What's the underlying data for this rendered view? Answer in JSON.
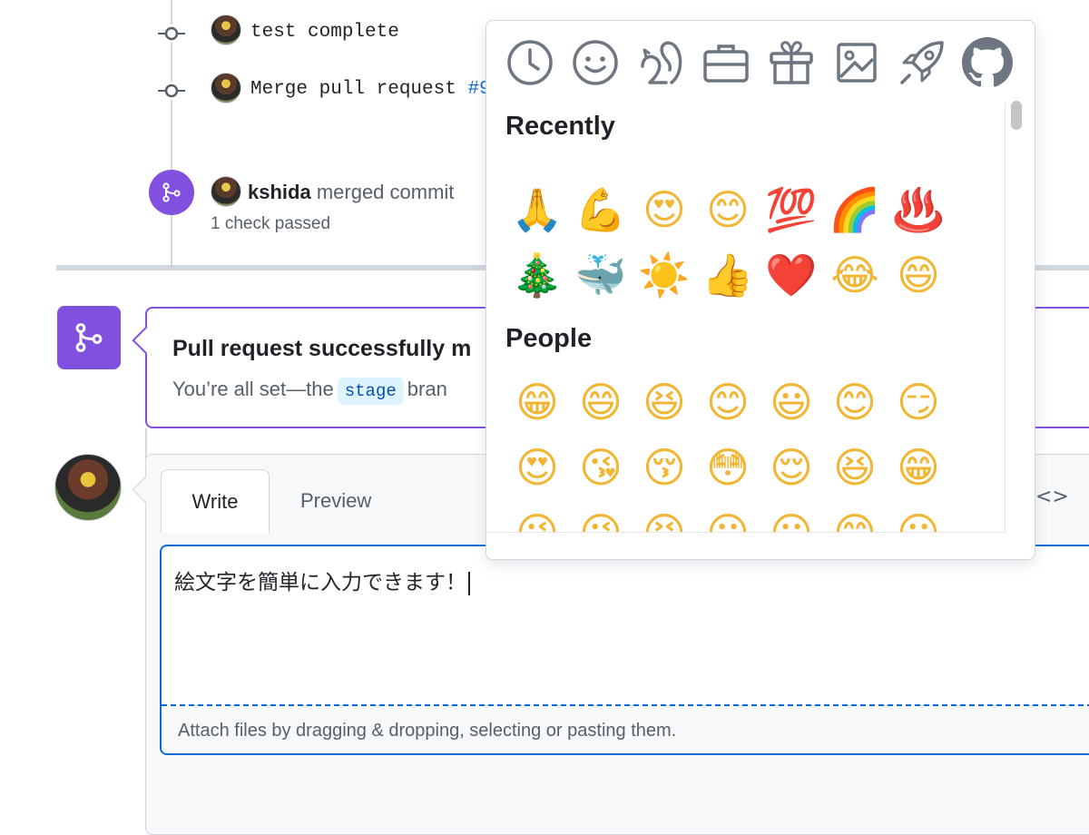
{
  "timeline": {
    "commits": [
      {
        "message": "test complete"
      },
      {
        "message_prefix": "Merge pull request ",
        "message_link": "#9"
      }
    ],
    "merge_event": {
      "user": "kshida",
      "action": "merged commit",
      "checks": "1 check passed"
    }
  },
  "merged_box": {
    "title": "Pull request successfully m",
    "desc_prefix": "You’re all set—the",
    "branch": "stage",
    "desc_suffix": "bran"
  },
  "composer": {
    "tabs": {
      "write": "Write",
      "preview": "Preview"
    },
    "text": "絵文字を簡単に入力できます！",
    "attach_hint": "Attach files by dragging & dropping, selecting or pasting them.",
    "code_toggle": "<>"
  },
  "emoji_picker": {
    "categories": [
      "clock-icon",
      "smiley-icon",
      "squirrel-icon",
      "briefcase-icon",
      "gift-icon",
      "image-icon",
      "rocket-icon",
      "github-icon"
    ],
    "sections": [
      {
        "title": "Recently",
        "rows": [
          [
            "🙏",
            "💪",
            "😍",
            "😊",
            "💯",
            "🌈",
            "♨️"
          ],
          [
            "🎄",
            "🐳",
            "☀️",
            "👍",
            "❤️",
            "😂",
            "😄"
          ]
        ]
      },
      {
        "title": "People",
        "rows": [
          [
            "😁",
            "😄",
            "😆",
            "😊",
            "😃",
            "😊",
            "😏"
          ],
          [
            "😍",
            "😘",
            "😚",
            "😳",
            "😌",
            "😆",
            "😁"
          ],
          [
            "😉",
            "😜",
            "😝",
            "😀",
            "😗",
            "😙",
            "😛"
          ]
        ]
      }
    ]
  },
  "colors": {
    "accent": "#0969da",
    "merged": "#8250df",
    "border": "#d0d7de"
  }
}
